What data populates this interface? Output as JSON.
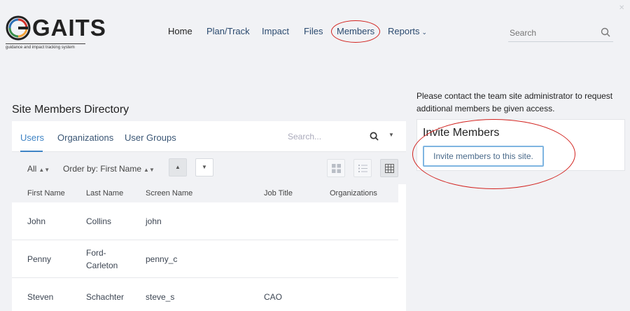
{
  "brand": {
    "name": "GAITS",
    "tagline": "guidance and impact tracking system",
    "colors": [
      "#d3322b",
      "#f2a33a",
      "#3a8f4a",
      "#2c6fb5"
    ]
  },
  "nav": {
    "items": [
      {
        "label": "Home"
      },
      {
        "label": "Plan/Track"
      },
      {
        "label": "Impact"
      },
      {
        "label": "Files"
      },
      {
        "label": "Members"
      },
      {
        "label": "Reports"
      }
    ],
    "highlight_color": "#d2231f"
  },
  "search": {
    "placeholder": "Search"
  },
  "directory": {
    "title": "Site Members Directory",
    "tabs": [
      {
        "label": "Users"
      },
      {
        "label": "Organizations"
      },
      {
        "label": "User Groups"
      }
    ],
    "search_placeholder": "Search...",
    "filter": "All",
    "order_by": "Order by: First Name",
    "columns": [
      "First Name",
      "Last Name",
      "Screen Name",
      "Job Title",
      "Organizations"
    ],
    "rows": [
      {
        "first": "John",
        "last": "Collins",
        "screen": "john",
        "job": "",
        "org": ""
      },
      {
        "first": "Penny",
        "last": "Ford-\nCarleton",
        "screen": "penny_c",
        "job": "",
        "org": ""
      },
      {
        "first": "Steven",
        "last": "Schachter",
        "screen": "steve_s",
        "job": "CAO",
        "org": ""
      }
    ]
  },
  "invite": {
    "notice": "Please contact the team site administrator to request additional members be given access.",
    "title": "Invite Members",
    "button_label": "Invite members to this site."
  }
}
